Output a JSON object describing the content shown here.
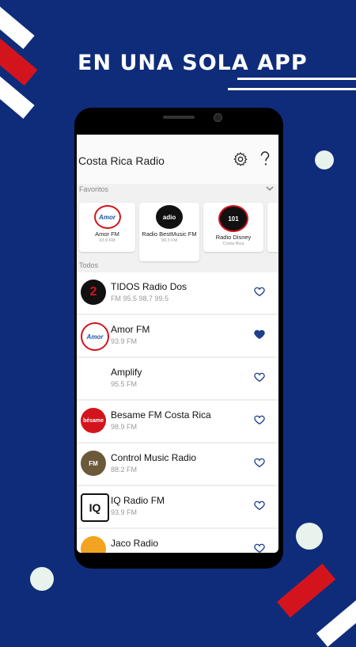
{
  "colors": {
    "background": "#0f2c7a",
    "accent": "#1f3f8a",
    "red": "#d4141c"
  },
  "headline": "EN UNA SOLA APP",
  "app": {
    "title": "Costa Rica Radio",
    "settings_icon": "gear-icon",
    "help_icon": "question-mark-icon",
    "favorites_label": "Favoritos",
    "all_label": "Todos",
    "favorites": [
      {
        "name": "Amor FM",
        "sub": "93.9 FM"
      },
      {
        "name": "Radio BestMusic FM",
        "sub": "90.3 FM"
      },
      {
        "name": "Radio Disney",
        "sub": "Costa Rica"
      }
    ],
    "stations": [
      {
        "name": "TIDOS Radio Dos",
        "freq": "FM 95.5 98.7 99.5",
        "favorite": false
      },
      {
        "name": "Amor FM",
        "freq": "93.9 FM",
        "favorite": true
      },
      {
        "name": "Amplify",
        "freq": "95.5 FM",
        "favorite": false
      },
      {
        "name": "Besame FM Costa Rica",
        "freq": "98.9 FM",
        "favorite": false
      },
      {
        "name": "Control Music Radio",
        "freq": "88.2 FM",
        "favorite": false
      },
      {
        "name": "IQ Radio FM",
        "freq": "93.9 FM",
        "favorite": false
      },
      {
        "name": "Jaco Radio",
        "freq": "",
        "favorite": false
      }
    ]
  }
}
